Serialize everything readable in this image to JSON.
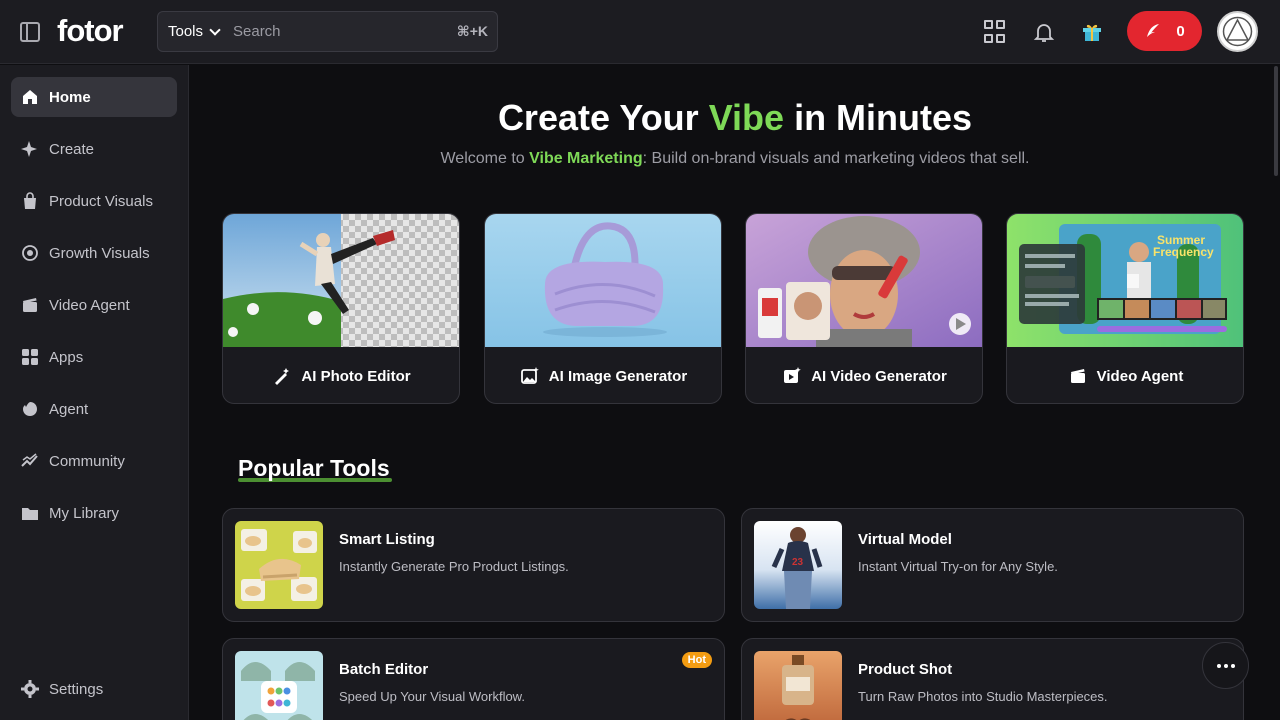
{
  "topbar": {
    "logo": "fotor",
    "tools_label": "Tools",
    "search_placeholder": "Search",
    "shortcut": "⌘+K",
    "credits": "0"
  },
  "sidebar": {
    "items": [
      {
        "label": "Home",
        "icon": "home-icon",
        "active": true
      },
      {
        "label": "Create",
        "icon": "sparkle-icon"
      },
      {
        "label": "Product Visuals",
        "icon": "shopping-bag-icon"
      },
      {
        "label": "Growth Visuals",
        "icon": "target-icon"
      },
      {
        "label": "Video Agent",
        "icon": "video-clapper-icon"
      },
      {
        "label": "Apps",
        "icon": "apps-grid-icon"
      },
      {
        "label": "Agent",
        "icon": "agent-icon"
      },
      {
        "label": "Community",
        "icon": "community-icon"
      },
      {
        "label": "My Library",
        "icon": "folder-icon"
      }
    ],
    "settings_label": "Settings"
  },
  "hero": {
    "title_pre": "Create Your ",
    "title_accent": "Vibe",
    "title_post": " in Minutes",
    "sub_pre": "Welcome to ",
    "sub_accent": "Vibe Marketing",
    "sub_post": ": Build on-brand visuals and marketing videos that sell."
  },
  "features": [
    {
      "label": "AI Photo Editor",
      "icon": "magic-wand-icon"
    },
    {
      "label": "AI Image Generator",
      "icon": "image-sparkle-icon"
    },
    {
      "label": "AI Video Generator",
      "icon": "video-sparkle-icon"
    },
    {
      "label": "Video Agent",
      "icon": "video-clapper-icon"
    }
  ],
  "popular": {
    "title": "Popular Tools",
    "tools": [
      {
        "name": "Smart Listing",
        "desc": "Instantly Generate Pro Product Listings."
      },
      {
        "name": "Virtual Model",
        "desc": "Instant Virtual Try-on for Any Style."
      },
      {
        "name": "Batch Editor",
        "desc": "Speed Up Your Visual Workflow.",
        "badge": "Hot"
      },
      {
        "name": "Product Shot",
        "desc": "Turn Raw Photos into Studio Masterpieces."
      }
    ]
  },
  "colors": {
    "accent": "#7ed957",
    "credits_bg": "#e3262f",
    "hot_badge": "#f39c12"
  }
}
